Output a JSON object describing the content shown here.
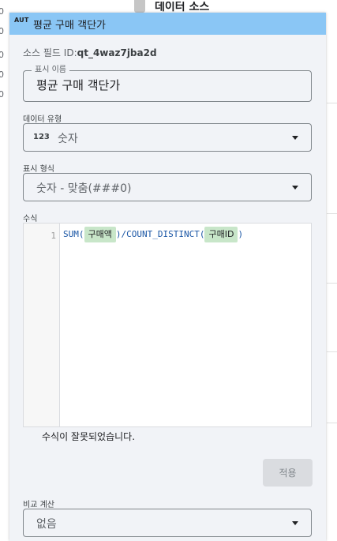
{
  "background": {
    "left_numbers": [
      "0",
      "0",
      "0",
      "0",
      "0"
    ],
    "heading": "데이터 소스"
  },
  "dialog": {
    "header_icon": "AUT",
    "title": "평균 구매 객단가",
    "source_id_label": "소스 필드 ID:",
    "source_id_value": "qt_4waz7jba2d"
  },
  "display_name": {
    "legend": "표시 이름",
    "value": "평균 구매 객단가"
  },
  "data_type": {
    "label": "데이터 유형",
    "icon": "123",
    "value": "숫자"
  },
  "display_format": {
    "label": "표시 형식",
    "value": "숫자 - 맞춤(###0)"
  },
  "formula": {
    "label": "수식",
    "line_number": "1",
    "part1": "SUM(",
    "chip1": "구매액",
    "part2": ")/COUNT_DISTINCT(",
    "chip2": "구매ID",
    "part3": ")",
    "error": "수식이 잘못되었습니다."
  },
  "apply_label": "적용",
  "comparison": {
    "label": "비교 계산",
    "value": "없음"
  }
}
